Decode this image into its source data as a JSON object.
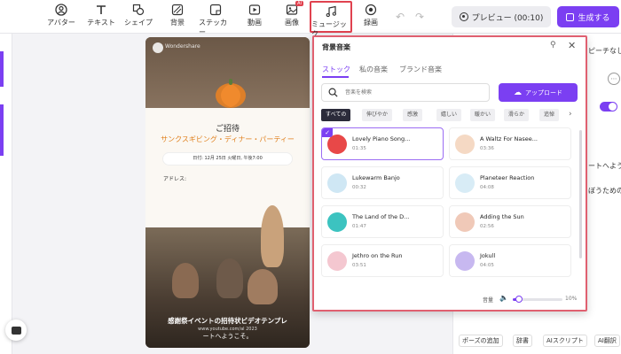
{
  "toolbar": {
    "items": [
      {
        "label": "アバター",
        "icon": "avatar-icon"
      },
      {
        "label": "テキスト",
        "icon": "text-icon"
      },
      {
        "label": "シェイプ",
        "icon": "shape-icon"
      },
      {
        "label": "背景",
        "icon": "background-icon"
      },
      {
        "label": "ステッカー",
        "icon": "sticker-icon"
      },
      {
        "label": "動画",
        "icon": "video-icon"
      },
      {
        "label": "画像",
        "icon": "image-icon"
      },
      {
        "label": "ミュージック",
        "icon": "music-icon"
      },
      {
        "label": "録画",
        "icon": "record-icon"
      }
    ],
    "ai_badge": "AI",
    "preview_label": "プレビュー (00:10)",
    "generate_label": "生成する",
    "accent": "#7b3ff2",
    "highlight": "#e0424f"
  },
  "canvas": {
    "brand_text": "Wondershare",
    "title": "ご招待",
    "subtitle": "サンクスギビング・ディナー・パーティー",
    "date": "日付: 12月 25日 火曜日, 午後7:00",
    "address_label": "アドレス:",
    "caption": "感謝祭イベントの招待状ビデオテンプレ",
    "url": "www.youtube.com/al 2023",
    "caption2": "ートへようこそ。",
    "pumpkin_color": "#f08a2d"
  },
  "right_panel": {
    "text1": "ピーチなし",
    "text2": "ートへよう",
    "text3": "ぼうための温",
    "bottom": [
      "ポーズの追加",
      "辞書",
      "AIスクリプト",
      "AI翻訳"
    ]
  },
  "music_panel": {
    "title": "背景音楽",
    "tabs": [
      "ストック",
      "私の音楽",
      "ブランド音楽"
    ],
    "search_placeholder": "音楽を検索",
    "upload_label": "アップロード",
    "filters": [
      "すべての",
      "伸びやか",
      "感激",
      "嬉しい",
      "暖かい",
      "滑らか",
      "追悼"
    ],
    "tracks": [
      {
        "name": "Lovely Piano Song...",
        "duration": "01:35",
        "selected": true,
        "color": "#e84848"
      },
      {
        "name": "A Waltz For Nasee...",
        "duration": "03:36",
        "selected": false,
        "color": "#f5d9c4"
      },
      {
        "name": "Lukewarm Banjo",
        "duration": "00:32",
        "selected": false,
        "color": "#cfe7f4"
      },
      {
        "name": "Planeteer Reaction",
        "duration": "04:08",
        "selected": false,
        "color": "#d8ecf6"
      },
      {
        "name": "The Land of the D...",
        "duration": "01:47",
        "selected": false,
        "color": "#3cc3c0"
      },
      {
        "name": "Adding the Sun",
        "duration": "02:56",
        "selected": false,
        "color": "#f0c9b8"
      },
      {
        "name": "Jethro on the Run",
        "duration": "03:51",
        "selected": false,
        "color": "#f4c7d0"
      },
      {
        "name": "Jokull",
        "duration": "04:05",
        "selected": false,
        "color": "#c7b8f0"
      }
    ],
    "volume_label": "音量",
    "volume_value": "10%",
    "volume_level": 0.1
  }
}
